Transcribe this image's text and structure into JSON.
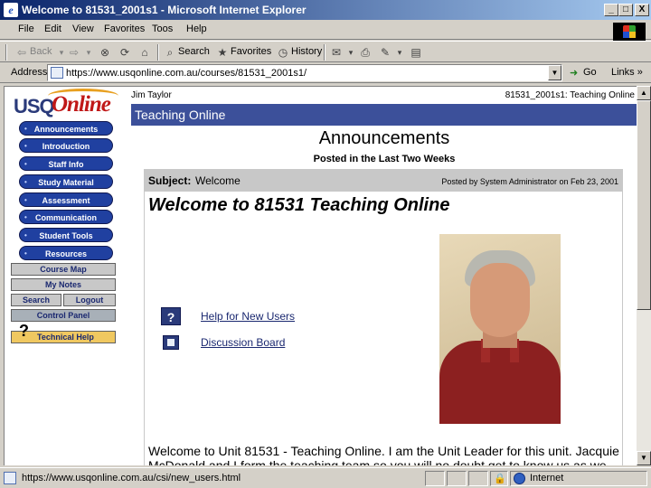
{
  "window": {
    "title": "Welcome to 81531_2001s1 - Microsoft Internet Explorer",
    "minimize": "_",
    "maximize": "□",
    "close": "X"
  },
  "menu": [
    "File",
    "Edit",
    "View",
    "Favorites",
    "Toos",
    "Help"
  ],
  "toolbar": {
    "back": "Back",
    "search": "Search",
    "favorites": "Favorites",
    "history": "History"
  },
  "address": {
    "label": "Address",
    "url": "https://www.usqonline.com.au/courses/81531_2001s1/",
    "go": "Go",
    "links": "Links »"
  },
  "nav": {
    "logo_usq": "USQ",
    "logo_online": "Online",
    "items": [
      "Announcements",
      "Introduction",
      "Staff Info",
      "Study Material",
      "Assessment",
      "Communication",
      "Student Tools",
      "Resources"
    ],
    "course_map": "Course Map",
    "my_notes": "My Notes",
    "search": "Search",
    "logout": "Logout",
    "control_panel": "Control Panel",
    "technical_help": "Technical Help"
  },
  "header": {
    "user": "Jim Taylor",
    "unit": "81531_2001s1: Teaching Online",
    "band_title": "Teaching Online"
  },
  "page": {
    "heading": "Announcements",
    "subheading": "Posted in the Last Two Weeks"
  },
  "announcement": {
    "subject_label": "Subject:",
    "subject_value": "Welcome",
    "posted_by": "Posted by System Administrator on Feb 23, 2001",
    "title": "Welcome to 81531 Teaching Online",
    "links": [
      "Help for New Users",
      "Discussion Board"
    ],
    "body": "Welcome to Unit 81531 - Teaching Online. I am the Unit Leader for this unit. Jacquie McDonald and I form the teaching team so you will no doubt get to know us as we"
  },
  "status": {
    "text": "https://www.usqonline.com.au/csi/new_users.html",
    "zone": "Internet"
  }
}
